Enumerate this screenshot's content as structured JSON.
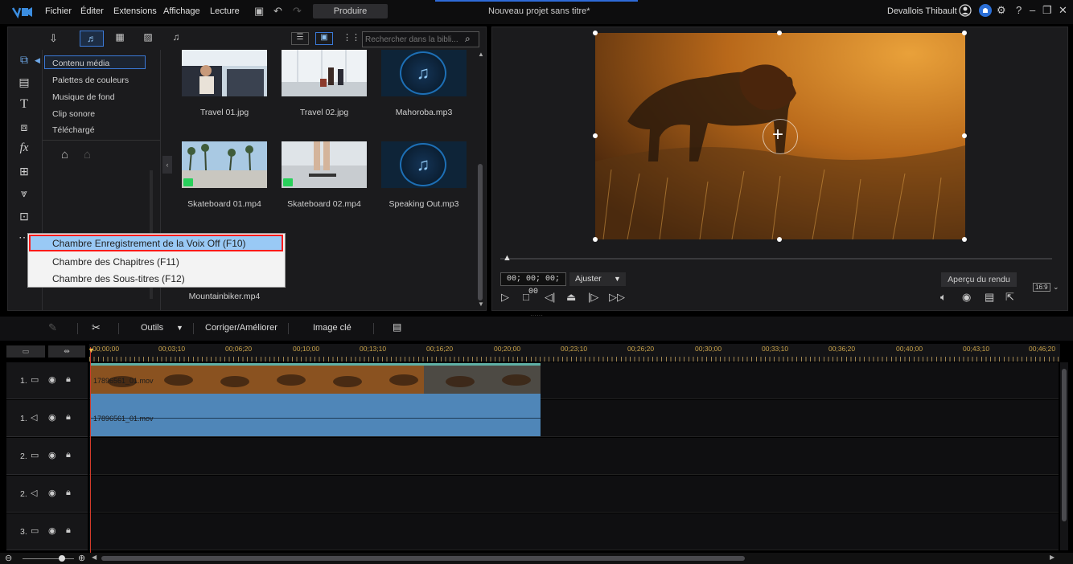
{
  "titlebar": {
    "menu": [
      "Fichier",
      "Éditer",
      "Extensions",
      "Affichage",
      "Lecture"
    ],
    "produce": "Produire",
    "project_title": "Nouveau projet sans titre*",
    "user": "Devallois Thibault"
  },
  "library": {
    "search_placeholder": "Rechercher dans la bibli...",
    "categories": [
      "Contenu média",
      "Palettes de couleurs",
      "Musique de fond",
      "Clip sonore",
      "Téléchargé"
    ],
    "items": [
      {
        "label": "Travel 01.jpg",
        "kind": "image"
      },
      {
        "label": "Travel 02.jpg",
        "kind": "image"
      },
      {
        "label": "Mahoroba.mp3",
        "kind": "audio"
      },
      {
        "label": "Skateboard 01.mp4",
        "kind": "video"
      },
      {
        "label": "Skateboard 02.mp4",
        "kind": "video"
      },
      {
        "label": "Speaking Out.mp3",
        "kind": "audio"
      },
      {
        "label": "Mountainbiker.mp4",
        "kind": "video"
      }
    ]
  },
  "context_menu": {
    "items": [
      "Chambre Enregistrement de la Voix Off (F10)",
      "Chambre des Chapitres (F11)",
      "Chambre des Sous-titres (F12)"
    ]
  },
  "preview": {
    "timecode": "00; 00; 00; 00",
    "fit": "Ajuster",
    "render_preview": "Aperçu du rendu",
    "aspect": "16:9"
  },
  "timeline_toolbar": {
    "tools": "Outils",
    "fix": "Corriger/Améliorer",
    "keyframe": "Image clé"
  },
  "ruler": [
    "00;00;00",
    "00;03;10",
    "00;06;20",
    "00;10;00",
    "00;13;10",
    "00;16;20",
    "00;20;00",
    "00;23;10",
    "00;26;20",
    "00;30;00",
    "00;33;10",
    "00;36;20",
    "00;40;00",
    "00;43;10",
    "00;46;20"
  ],
  "tracks": [
    {
      "num": "1.",
      "type": "video"
    },
    {
      "num": "1.",
      "type": "audio"
    },
    {
      "num": "2.",
      "type": "video"
    },
    {
      "num": "2.",
      "type": "audio"
    },
    {
      "num": "3.",
      "type": "video"
    }
  ],
  "clips": {
    "video_label": "17896561_01.mov",
    "audio_label": "17896561_01.mov"
  },
  "colors": {
    "accent": "#3b7ad8",
    "ruler_text": "#c8a24a",
    "audio_clip": "#4f86b8",
    "highlight": "#99c9f5",
    "highlight_border": "#ff1a1a"
  }
}
